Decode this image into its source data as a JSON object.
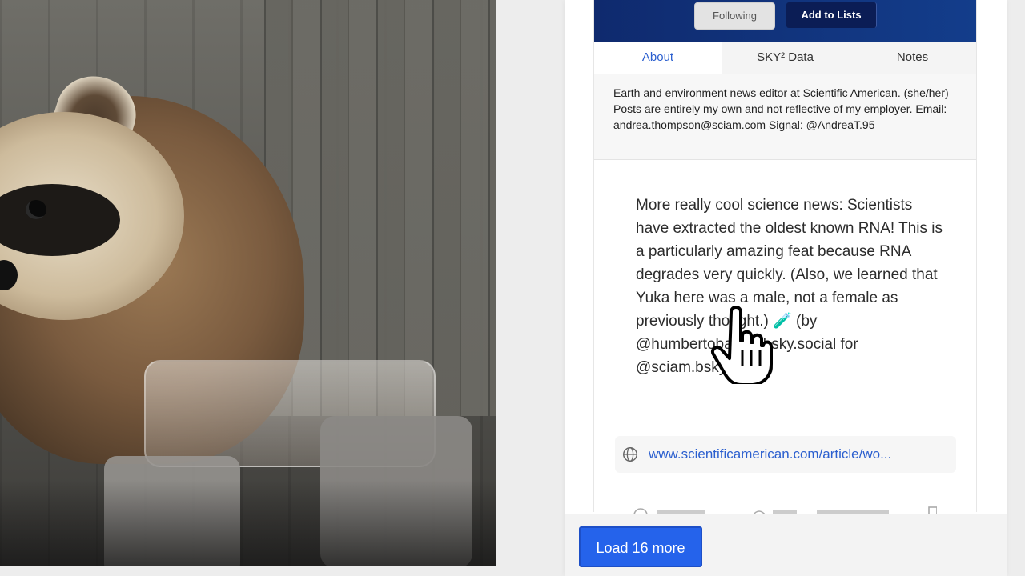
{
  "profile": {
    "following_label": "Following",
    "add_to_lists_label": "Add to Lists"
  },
  "tabs": [
    {
      "label": "About"
    },
    {
      "label": "SKY² Data"
    },
    {
      "label": "Notes"
    }
  ],
  "bio": "Earth and environment news editor at Scientific American. (she/her) Posts are entirely my own and not reflective of my employer. Email: andrea.thompson@sciam.com Signal: @AndreaT.95",
  "post": {
    "text": "More really cool science news: Scientists have extracted the oldest known RNA! This is a particularly amazing feat because RNA degrades very quickly. (Also, we learned that Yuka here was a male, not a female as previously thought.) 🧪 (by @humbertobasilio.bsky.social for @sciam.bsky.social)",
    "link": "www.scientificamerican.com/article/wo...",
    "link_icon": "globe-icon"
  },
  "load_more_label": "Load 16 more",
  "colors": {
    "header": "#133d8b",
    "accent": "#2563eb",
    "link": "#2b5fcf"
  }
}
